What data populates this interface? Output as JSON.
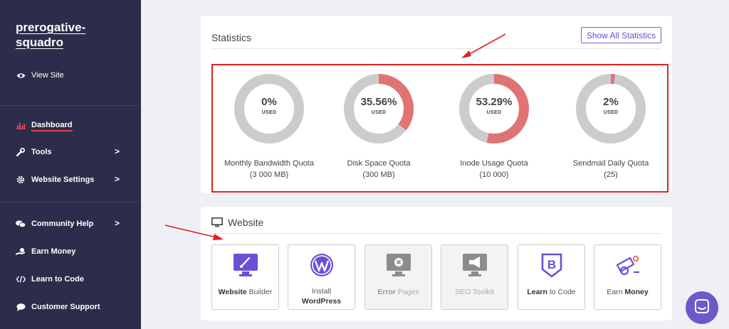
{
  "sidebar": {
    "brand": "prerogative-squadro",
    "items": [
      {
        "label": "View Site",
        "icon": "eye-icon"
      },
      {
        "label": "Dashboard",
        "icon": "chart-icon",
        "active": true
      },
      {
        "label": "Tools",
        "icon": "wrench-icon",
        "chevron": ">"
      },
      {
        "label": "Website Settings",
        "icon": "gear-icon",
        "chevron": ">"
      },
      {
        "label": "Community Help",
        "icon": "chat-icon",
        "chevron": ">"
      },
      {
        "label": "Earn Money",
        "icon": "money-icon"
      },
      {
        "label": "Learn to Code",
        "icon": "code-icon"
      },
      {
        "label": "Customer Support",
        "icon": "support-icon"
      }
    ]
  },
  "statistics": {
    "title": "Statistics",
    "show_all": "Show All Statistics",
    "used_label": "USED",
    "quotas": [
      {
        "percent": "0%",
        "fraction": 0,
        "name": "Monthly Bandwidth Quota",
        "limit": "(3 000 MB)"
      },
      {
        "percent": "35.56%",
        "fraction": 0.3556,
        "name": "Disk Space Quota",
        "limit": "(300 MB)"
      },
      {
        "percent": "53.29%",
        "fraction": 0.5329,
        "name": "Inode Usage Quota",
        "limit": "(10 000)"
      },
      {
        "percent": "2%",
        "fraction": 0.02,
        "name": "Sendmail Daily Quota",
        "limit": "(25)"
      }
    ],
    "colors": {
      "track": "#cccccc",
      "fill": "#e07474"
    }
  },
  "website": {
    "title": "Website",
    "tiles": [
      {
        "bold": "Website",
        "rest": " Builder",
        "icon": "monitor-brush-icon",
        "enabled": true
      },
      {
        "line1": "Install",
        "bold": "WordPress",
        "icon": "wordpress-icon",
        "enabled": true
      },
      {
        "bold": "Error",
        "rest": " Pages",
        "icon": "monitor-error-icon",
        "enabled": false
      },
      {
        "bold": "",
        "rest": "SEO Toolkit",
        "icon": "megaphone-icon",
        "enabled": false
      },
      {
        "bold": "Learn",
        "rest": " to Code",
        "icon": "bootstrap-icon",
        "enabled": true
      },
      {
        "rest": "Earn ",
        "bold2": "Money",
        "icon": "cannon-icon",
        "enabled": true
      }
    ]
  },
  "accent": "#5b4fd4"
}
